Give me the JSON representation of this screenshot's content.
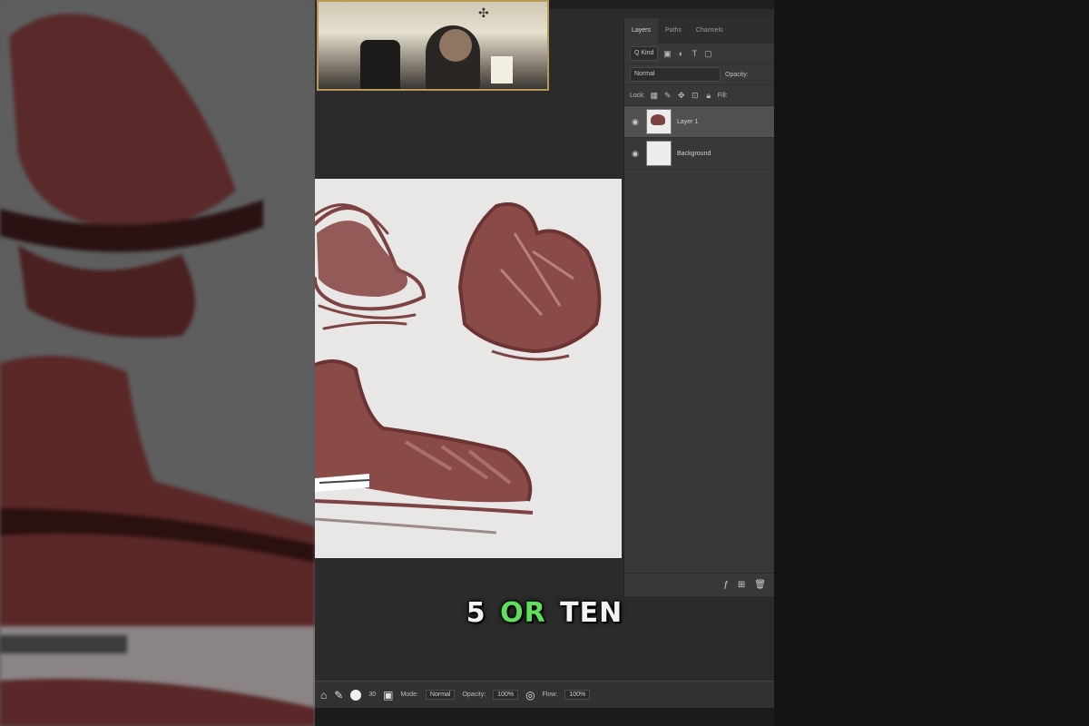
{
  "caption": {
    "num": "5",
    "or": "OR",
    "ten": "TEN"
  },
  "layers_panel": {
    "tabs": [
      "Layers",
      "Paths",
      "Channels"
    ],
    "kind": "Q Kind",
    "blend_mode": "Normal",
    "opacity_label": "Opacity:",
    "lock_label": "Lock:",
    "fill_label": "Fill:",
    "layers": [
      {
        "name": "Layer 1",
        "selected": true
      },
      {
        "name": "Background",
        "selected": false
      }
    ]
  },
  "toolbar": {
    "size_value": "30",
    "mode_label": "Mode:",
    "mode_value": "Normal",
    "opacity_label": "Opacity:",
    "opacity_value": "100%",
    "flow_label": "Flow:",
    "flow_value": "100%"
  },
  "colors": {
    "accent_caption": "#5ee05a",
    "sketch": "#7d4342",
    "canvas": "#e9e6e6",
    "webcam_border": "#b89a55"
  },
  "icons": [
    "home-icon",
    "brush-icon",
    "eye-icon",
    "lock-icon",
    "fx-icon",
    "trash-icon",
    "camera-icon"
  ]
}
